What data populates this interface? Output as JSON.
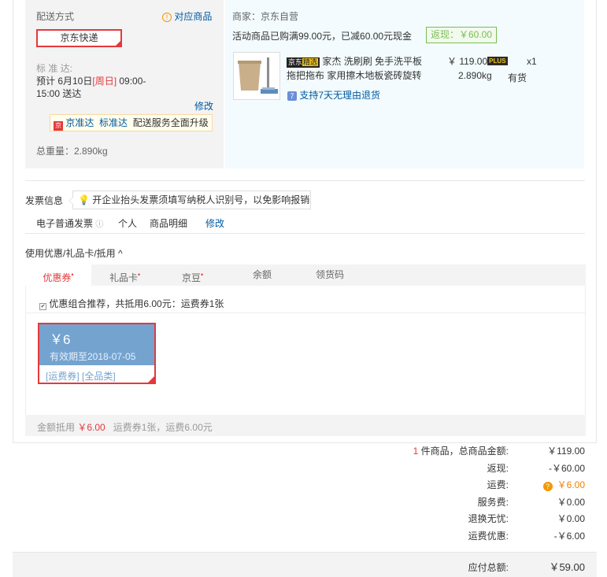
{
  "shipping": {
    "title": "配送方式",
    "related_goods": "对应商品",
    "selected": "京东快递",
    "standard_label": "标 准 达:",
    "eta_prefix": "预计 6月10日",
    "eta_day": "[周日]",
    "eta_time": "09:00-",
    "eta_time2": "15:00 送达",
    "modify": "修改",
    "jzd_name": "京准达",
    "jzd_std": "标准达",
    "jzd_text": "配送服务全面升级",
    "weight": "总重量：2.890kg"
  },
  "product": {
    "seller": "商家：京东自营",
    "promo": "活动商品已购满99.00元，已减60.00元现金",
    "rebate": "返现：￥60.00",
    "logo_text": "京东",
    "logo_badge": "精选",
    "name_line1": "家杰 洗刷刷 免手洗平板",
    "name_line2": "拖把拖布 家用擦木地板瓷砖旋转",
    "price": "￥ 119.00",
    "plus": "PLUS",
    "qty": "x1",
    "weight": "2.890kg",
    "stock": "有货",
    "return_policy": "支持7天无理由退货"
  },
  "invoice": {
    "title": "发票信息",
    "tip": "开企业抬头发票须填写纳税人识别号，以免影响报销",
    "type": "电子普通发票",
    "info_icon": "ⓘ",
    "holder": "个人",
    "content": "商品明细",
    "modify": "修改"
  },
  "discount": {
    "title": "使用优惠/礼品卡/抵用",
    "tabs": [
      "优惠券",
      "礼品卡",
      "京豆",
      "余额",
      "领货码"
    ],
    "tab_marks": [
      "•",
      "•",
      "•",
      "",
      ""
    ],
    "combo_text": "优惠组合推荐，共抵用6.00元：运费券1张",
    "coupon_amount": "￥6",
    "coupon_expiry": "有效期至2018-07-05",
    "coupon_type": "[运费券] [全品类]",
    "footer_prefix": "金额抵用",
    "footer_amount": "￥6.00",
    "footer_suffix": "运费券1张，运费6.00元"
  },
  "summary": {
    "count": "1",
    "count_label": "件商品，总商品金额:",
    "goods_total": "￥119.00",
    "rebate_label": "返现:",
    "rebate": "-￥60.00",
    "freight_label": "运费:",
    "freight": "￥6.00",
    "service_label": "服务费:",
    "service": "￥0.00",
    "return_label": "退换无忧:",
    "return_fee": "￥0.00",
    "freight_discount_label": "运费优惠:",
    "freight_discount": "-￥6.00",
    "payable_label": "应付总额:",
    "payable": "￥59.00"
  }
}
